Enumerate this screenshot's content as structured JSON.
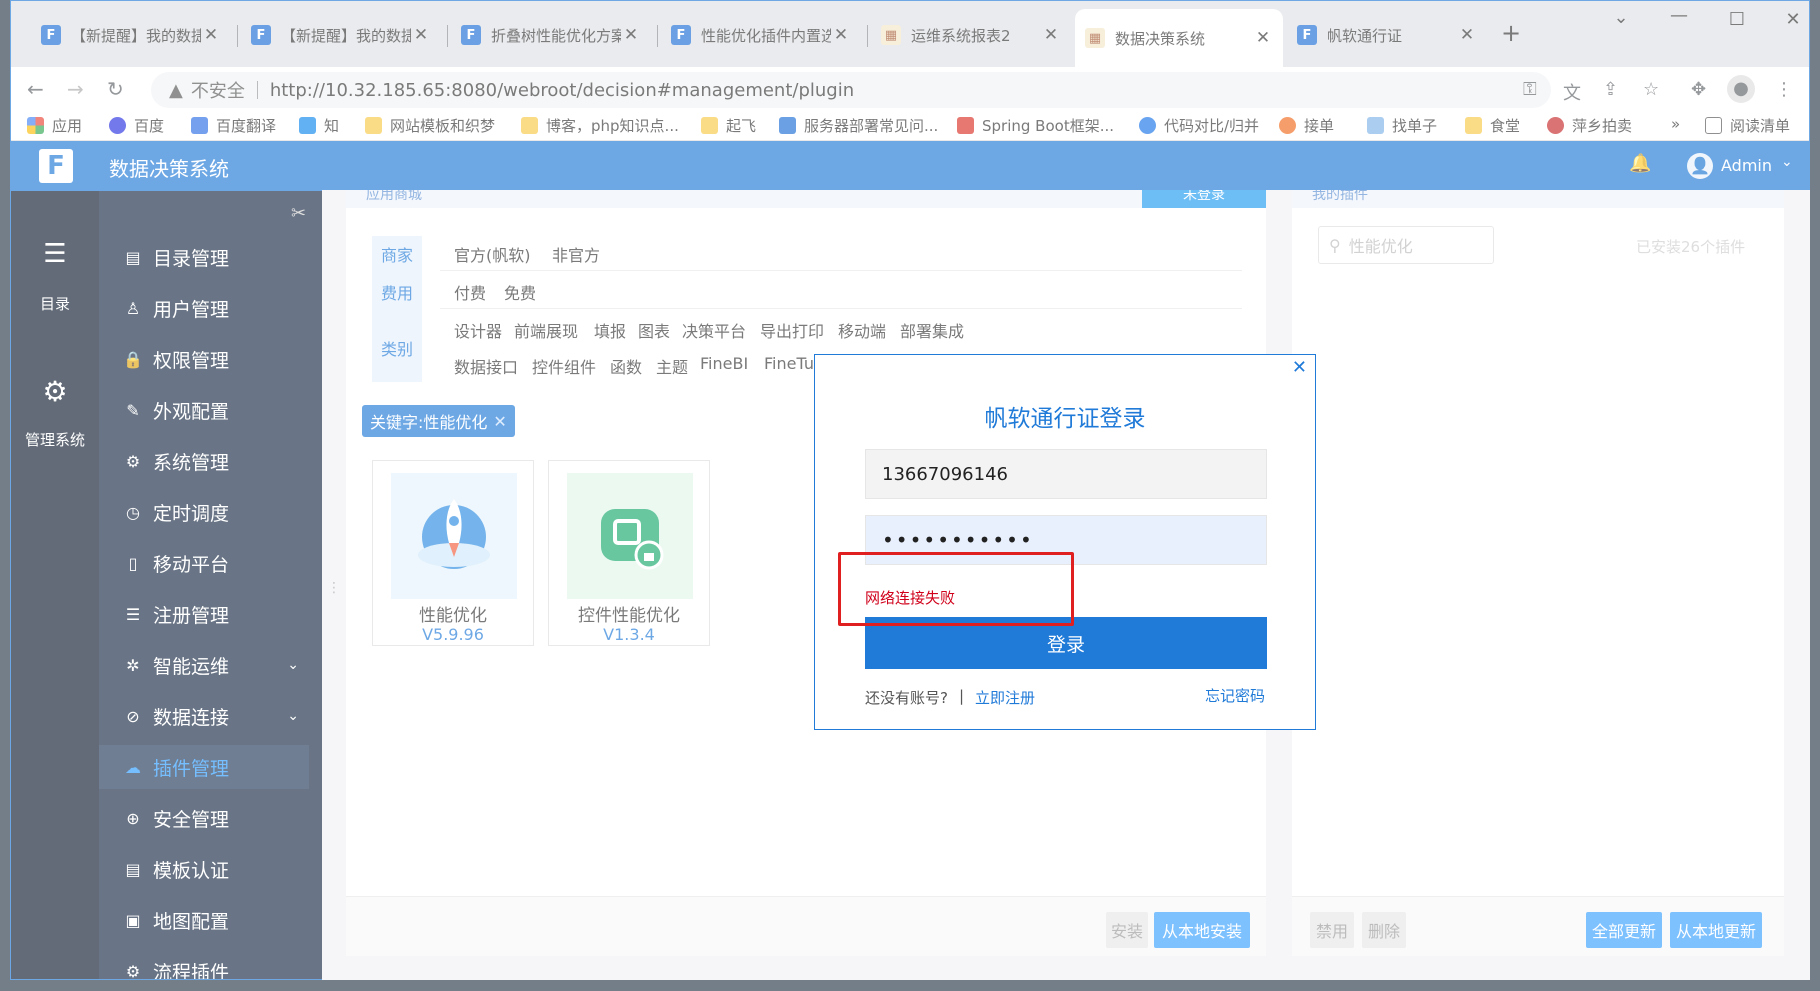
{
  "browser": {
    "tabs": [
      {
        "title": "【新提醒】我的数捷",
        "icon": "fanruan-icon"
      },
      {
        "title": "【新提醒】我的数捷",
        "icon": "fanruan-icon"
      },
      {
        "title": "折叠树性能优化方案",
        "icon": "fanruan-icon"
      },
      {
        "title": "性能优化插件内置选",
        "icon": "fanruan-icon"
      },
      {
        "title": "运维系统报表2",
        "icon": "report-icon"
      },
      {
        "title": "数据决策系统",
        "icon": "report-icon",
        "active": true
      },
      {
        "title": "帆软通行证",
        "icon": "fanruan-icon"
      }
    ],
    "new_tab": "+",
    "close_glyph": "✕",
    "address": {
      "security_label": "不安全",
      "url": "http://10.32.185.65:8080/webroot/decision#management/plugin"
    },
    "bookmarks": [
      {
        "label": "应用",
        "color": "#e94235"
      },
      {
        "label": "百度",
        "color": "#2932e1"
      },
      {
        "label": "百度翻译",
        "color": "#2b6de5"
      },
      {
        "label": "知",
        "color": "#0f88eb"
      },
      {
        "label": "网站模板和织梦",
        "color": "#f7c948"
      },
      {
        "label": "博客，php知识点...",
        "color": "#f7c948"
      },
      {
        "label": "起飞",
        "color": "#f7c948"
      },
      {
        "label": "服务器部署常见问...",
        "color": "#1d6fd6"
      },
      {
        "label": "Spring Boot框架...",
        "color": "#d93025"
      },
      {
        "label": "代码对比/归并",
        "color": "#1a73e8"
      },
      {
        "label": "接单",
        "color": "#f26b1d"
      },
      {
        "label": "找单子",
        "color": "#7fb3e8"
      },
      {
        "label": "食堂",
        "color": "#f7c948"
      },
      {
        "label": "萍乡拍卖",
        "color": "#c62828"
      }
    ],
    "more_bookmarks": "»",
    "reading_list": "阅读清单"
  },
  "app": {
    "title": "数据决策系统",
    "user": "Admin",
    "brand_color": "#1f7ad8"
  },
  "rail": [
    {
      "label": "目录",
      "icon": "list-icon"
    },
    {
      "label": "管理系统",
      "icon": "gear-icon"
    }
  ],
  "sidebar": [
    {
      "label": "目录管理",
      "icon": "catalog-icon",
      "glyph": "▤"
    },
    {
      "label": "用户管理",
      "icon": "user-icon",
      "glyph": "♙"
    },
    {
      "label": "权限管理",
      "icon": "lock-icon",
      "glyph": "🔒"
    },
    {
      "label": "外观配置",
      "icon": "brush-icon",
      "glyph": "✎"
    },
    {
      "label": "系统管理",
      "icon": "settings-icon",
      "glyph": "⚙"
    },
    {
      "label": "定时调度",
      "icon": "clock-icon",
      "glyph": "◷"
    },
    {
      "label": "移动平台",
      "icon": "mobile-icon",
      "glyph": "▯"
    },
    {
      "label": "注册管理",
      "icon": "register-icon",
      "glyph": "☰"
    },
    {
      "label": "智能运维",
      "icon": "ops-icon",
      "glyph": "✲",
      "expandable": true
    },
    {
      "label": "数据连接",
      "icon": "link-icon",
      "glyph": "⊘",
      "expandable": true
    },
    {
      "label": "插件管理",
      "icon": "plugin-icon",
      "glyph": "☁",
      "active": true
    },
    {
      "label": "安全管理",
      "icon": "shield-icon",
      "glyph": "⊕"
    },
    {
      "label": "模板认证",
      "icon": "template-icon",
      "glyph": "▤"
    },
    {
      "label": "地图配置",
      "icon": "map-icon",
      "glyph": "▣"
    },
    {
      "label": "流程插件",
      "icon": "flow-icon",
      "glyph": "⚙"
    }
  ],
  "store": {
    "header_label": "应用商城",
    "login_button": "未登录",
    "filters": {
      "merchant": {
        "tab": "商家",
        "options": [
          "官方(帆软)",
          "非官方"
        ]
      },
      "fee": {
        "tab": "费用",
        "options": [
          "付费",
          "免费"
        ]
      },
      "category": {
        "tab": "类别",
        "row1": [
          "设计器",
          "前端展现",
          "填报",
          "图表",
          "决策平台",
          "导出打印",
          "移动端",
          "部署集成"
        ],
        "row2": [
          "数据接口",
          "控件组件",
          "函数",
          "主题",
          "FineBI",
          "FineTu"
        ]
      }
    },
    "keyword_chip": "关键字:性能优化",
    "chip_close": "✕",
    "plugins": [
      {
        "name": "性能优化",
        "version": "V5.9.96",
        "icon": "rocket-icon"
      },
      {
        "name": "控件性能优化",
        "version": "V1.3.4",
        "icon": "widget-edit-icon"
      }
    ],
    "install_button": "安装",
    "local_install_button": "从本地安装"
  },
  "installed": {
    "header_label": "我的插件",
    "search_placeholder": "性能优化",
    "count_text": "已安装26个插件",
    "disable_button": "禁用",
    "delete_button": "删除",
    "update_all_button": "全部更新",
    "local_update_button": "从本地更新"
  },
  "login_modal": {
    "title": "帆软通行证登录",
    "username": "13667096146",
    "password": "•••••••••••",
    "error": "网络连接失败",
    "submit": "登录",
    "no_account": "还没有账号?",
    "register": "立即注册",
    "forgot": "忘记密码",
    "close": "✕"
  }
}
